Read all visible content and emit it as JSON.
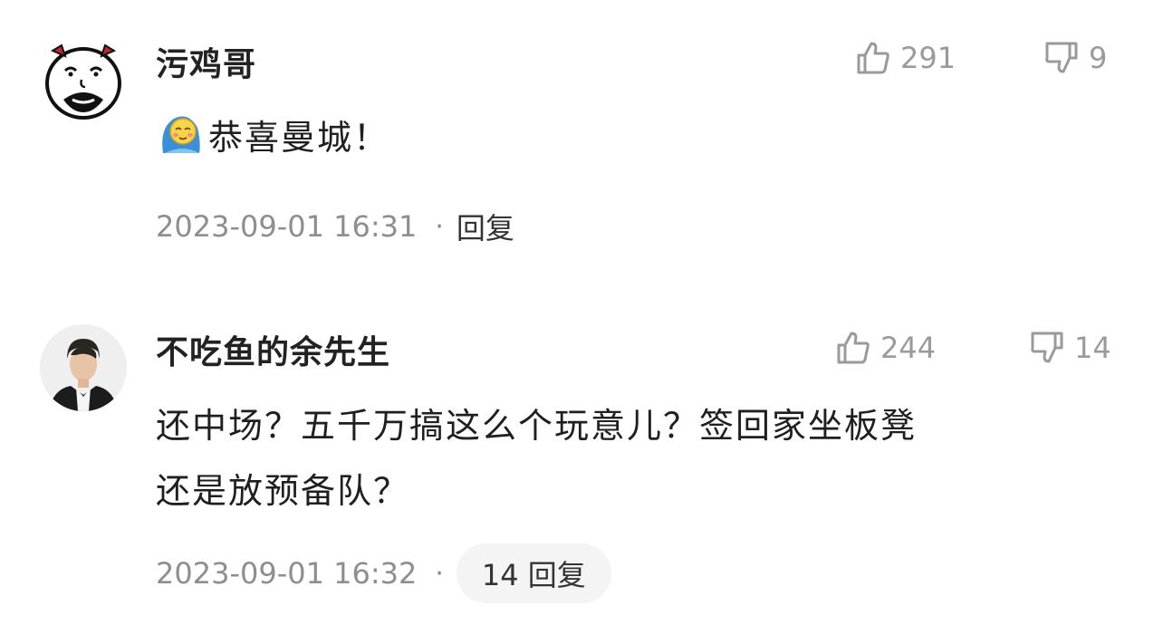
{
  "comments": [
    {
      "username": "污鸡哥",
      "likes": "291",
      "dislikes": "9",
      "text": "恭喜曼城！",
      "emoji_icon": "blushing-emoji-icon",
      "timestamp": "2023-09-01 16:31",
      "separator": "·",
      "reply_label": "回复"
    },
    {
      "username": "不吃鱼的余先生",
      "likes": "244",
      "dislikes": "14",
      "text_line1": "还中场？五千万搞这么个玩意儿？签回家坐板凳",
      "text_line2": "还是放预备队？",
      "timestamp": "2023-09-01 16:32",
      "separator": "·",
      "reply_label": "14 回复"
    }
  ],
  "colors": {
    "username": "#222222",
    "meta": "#8e8e8e",
    "vote": "#9a9a9a",
    "pill_bg": "#f4f4f4"
  }
}
